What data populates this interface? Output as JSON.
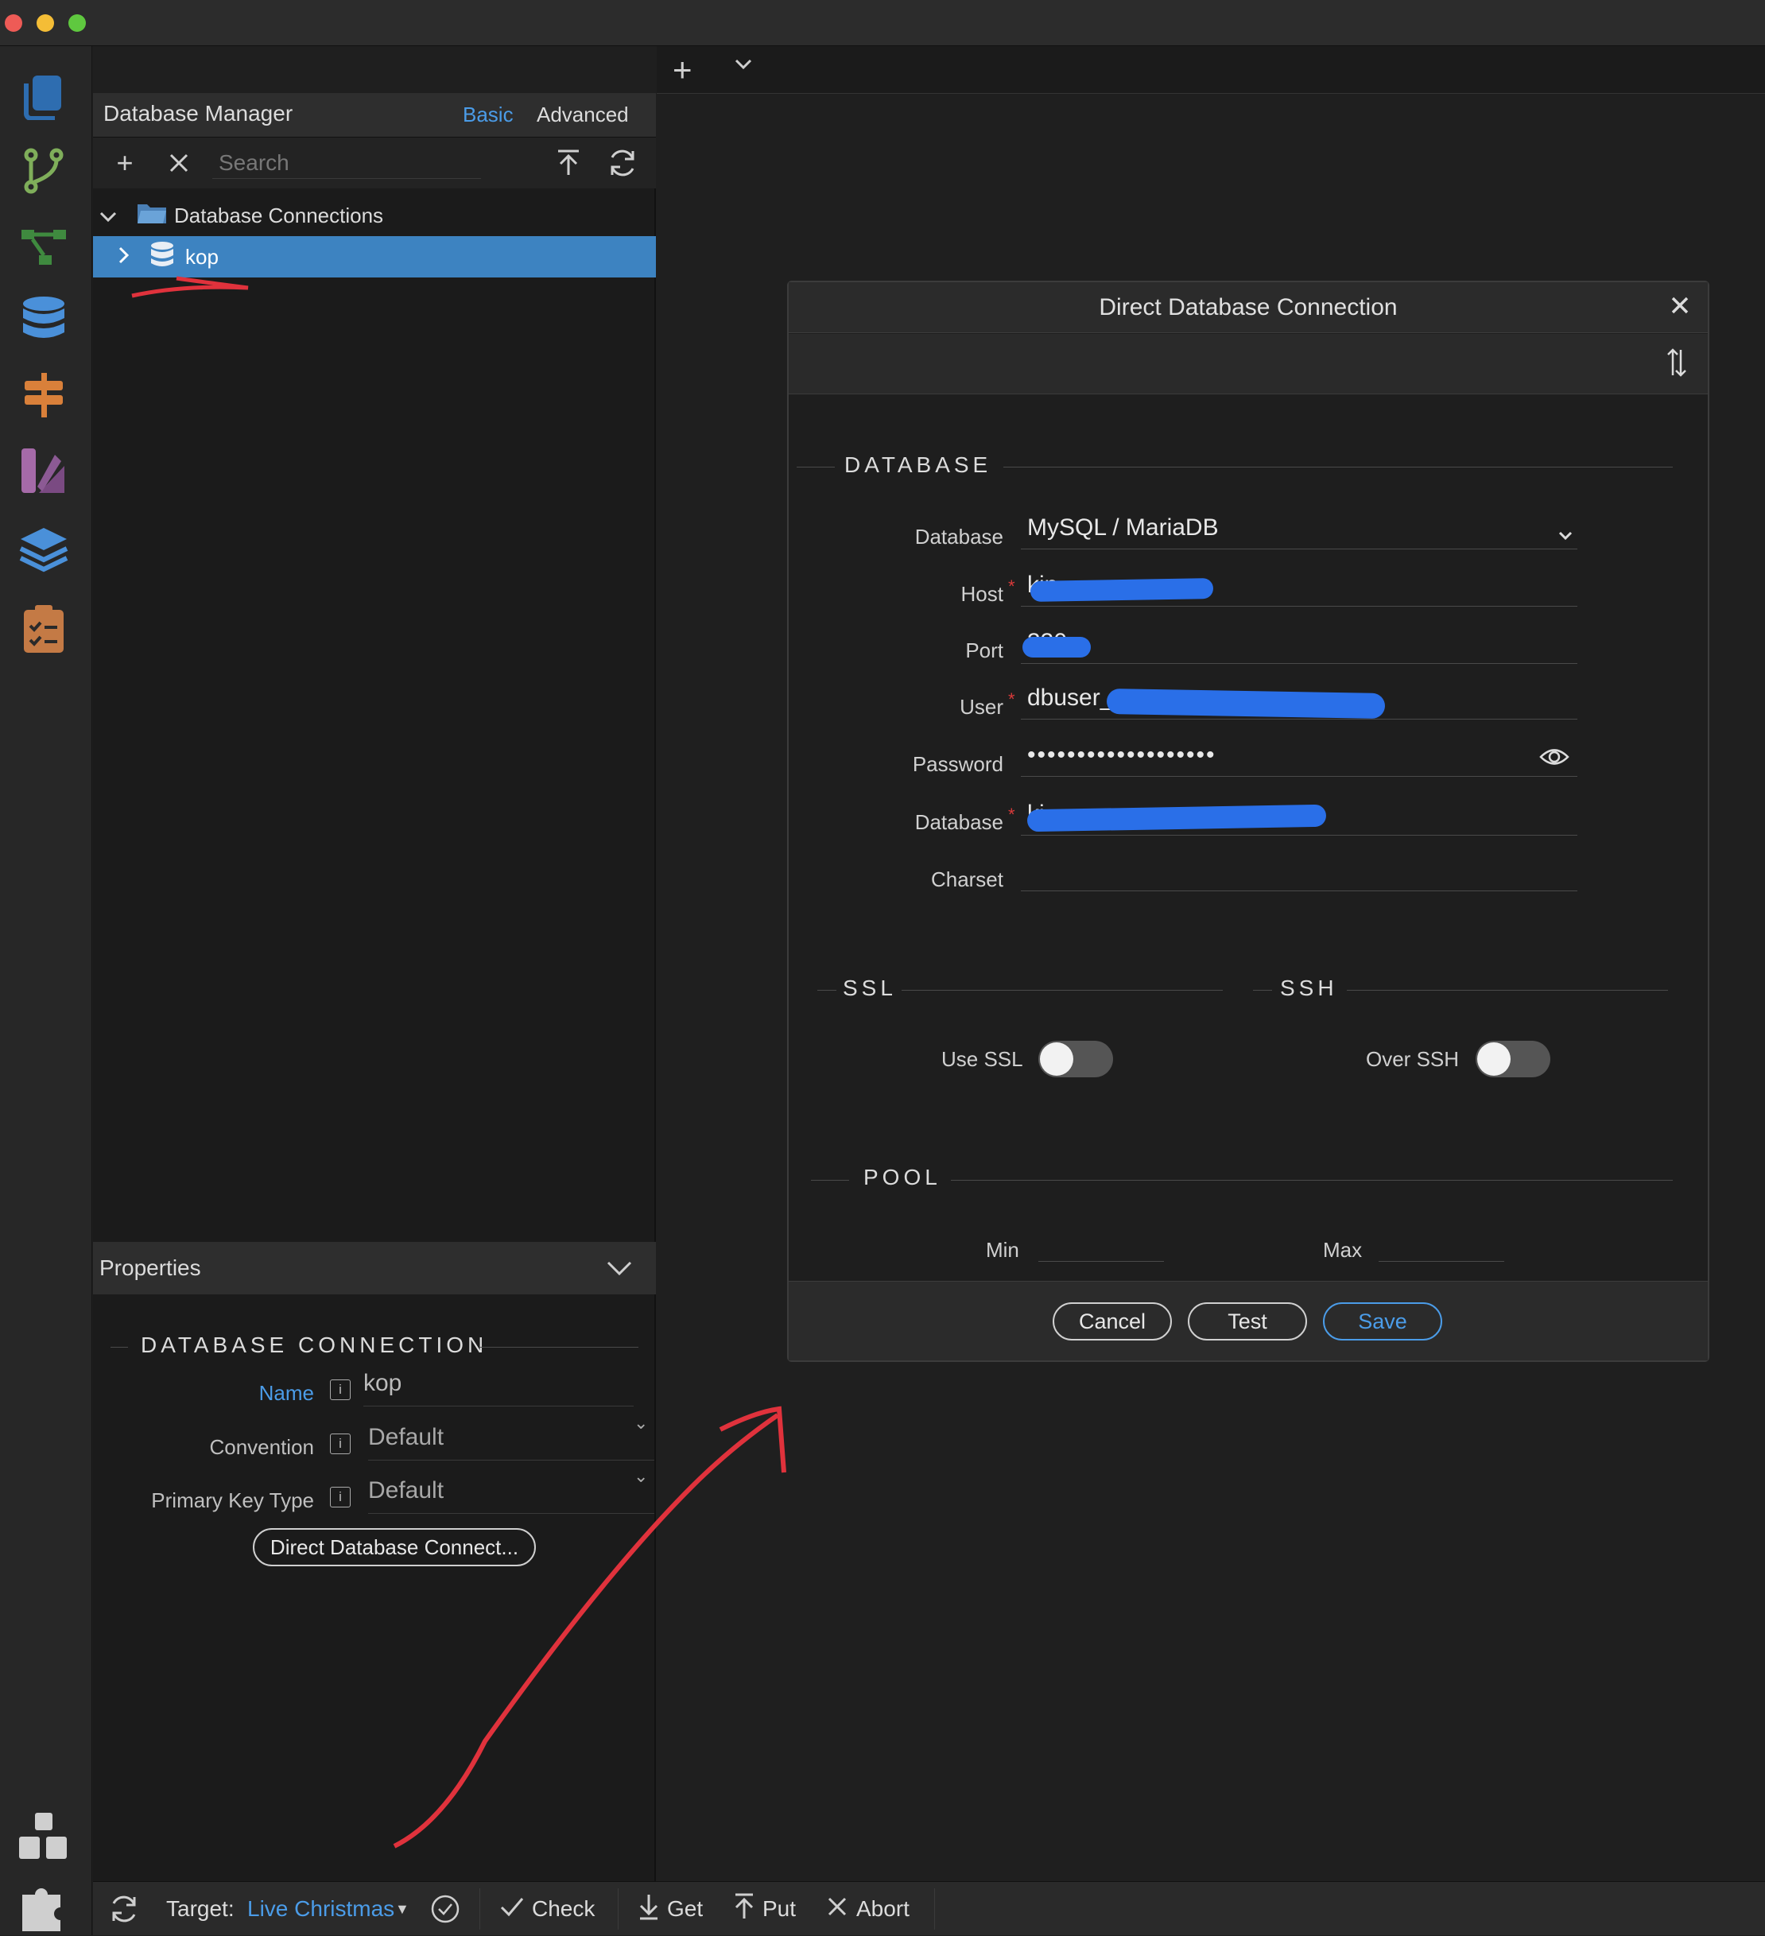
{
  "colors": {
    "accent_blue": "#3d83c1",
    "link_blue": "#4b9ce8",
    "required_red": "#d93a3a",
    "redaction_blue": "#2a6fe8",
    "annotation_red": "#e0323c"
  },
  "manager": {
    "title": "Database Manager",
    "tab_basic": "Basic",
    "tab_advanced": "Advanced",
    "search_placeholder": "Search",
    "tree": {
      "folder_label": "Database Connections",
      "connection_label": "kop"
    }
  },
  "properties": {
    "header": "Properties",
    "section_title": "DATABASE CONNECTION",
    "fields": [
      {
        "label": "Name",
        "value": "kop"
      },
      {
        "label": "Convention",
        "value": "Default"
      },
      {
        "label": "Primary Key Type",
        "value": "Default"
      }
    ],
    "direct_button": "Direct Database Connect..."
  },
  "dialog": {
    "title": "Direct Database Connection",
    "database_section": "DATABASE",
    "fields": {
      "database_type_label": "Database",
      "database_type_value": "MySQL / MariaDB",
      "host_label": "Host",
      "host_value": "kin",
      "port_label": "Port",
      "port_value": "330",
      "user_label": "User",
      "user_value": "dbuser_",
      "password_label": "Password",
      "password_value": "•••••••••••••••••••",
      "database_label": "Database",
      "database_value": "ki",
      "charset_label": "Charset",
      "charset_value": ""
    },
    "ssl_section": "SSL",
    "ssh_section": "SSH",
    "use_ssl_label": "Use SSL",
    "use_ssl": false,
    "over_ssh_label": "Over SSH",
    "over_ssh": false,
    "pool_section": "POOL",
    "pool_min_label": "Min",
    "pool_max_label": "Max",
    "buttons": {
      "cancel": "Cancel",
      "test": "Test",
      "save": "Save"
    }
  },
  "statusbar": {
    "target_label": "Target:",
    "target_value": "Live Christmas",
    "check": "Check",
    "get": "Get",
    "put": "Put",
    "abort": "Abort"
  }
}
